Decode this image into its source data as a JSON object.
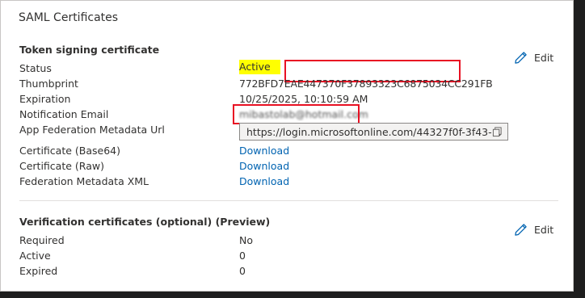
{
  "title": "SAML Certificates",
  "token_signing": {
    "heading": "Token signing certificate",
    "edit_label": "Edit",
    "rows": {
      "status": {
        "label": "Status",
        "value": "Active"
      },
      "thumbprint": {
        "label": "Thumbprint",
        "value": "772BFD7EAE447370F37893323C6875034CC291FB"
      },
      "expiration": {
        "label": "Expiration",
        "value": "10/25/2025, 10:10:59 AM"
      },
      "notification_email": {
        "label": "Notification Email",
        "value": "mibastolab@hotmail.com"
      },
      "metadata_url": {
        "label": "App Federation Metadata Url",
        "value": "https://login.microsoftonline.com/44327f0f-3f43-..."
      },
      "cert_base64": {
        "label": "Certificate (Base64)",
        "value": "Download"
      },
      "cert_raw": {
        "label": "Certificate (Raw)",
        "value": "Download"
      },
      "federation_xml": {
        "label": "Federation Metadata XML",
        "value": "Download"
      }
    }
  },
  "verification": {
    "heading": "Verification certificates (optional) (Preview)",
    "edit_label": "Edit",
    "rows": {
      "required": {
        "label": "Required",
        "value": "No"
      },
      "active": {
        "label": "Active",
        "value": "0"
      },
      "expired": {
        "label": "Expired",
        "value": "0"
      }
    }
  },
  "colors": {
    "link": "#0063b1",
    "highlight": "#ffff00",
    "annotation_red": "#e81123"
  },
  "icons": {
    "edit": "pencil-icon",
    "copy": "copy-icon"
  }
}
